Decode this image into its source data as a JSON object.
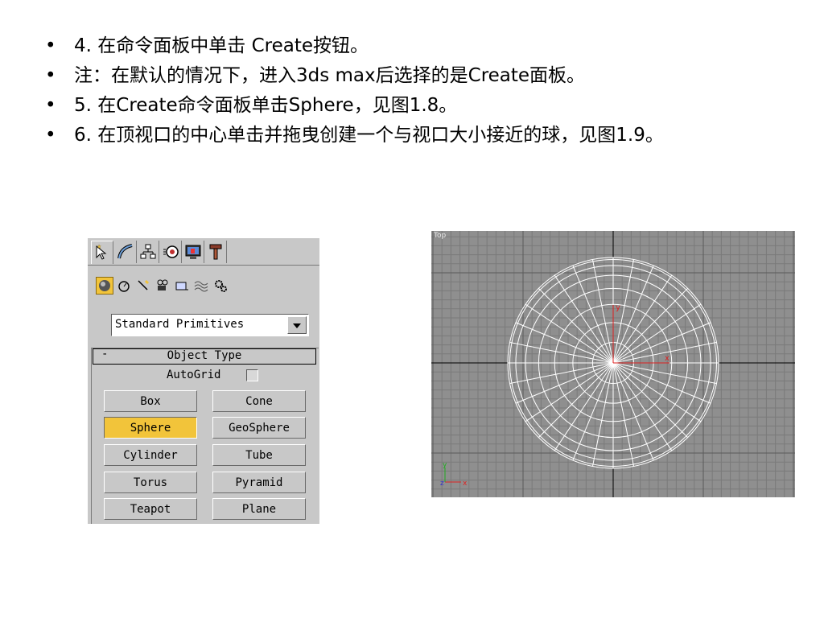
{
  "bullets": [
    "4. 在命令面板中单击  Create按钮。",
    "注：在默认的情况下，进入3ds max后选择的是Create面板。",
    "5. 在Create命令面板单击Sphere，见图1.8。",
    "6. 在顶视口的中心单击并拖曳创建一个与视口大小接近的球，见图1.9。"
  ],
  "bullet_symbol": "•",
  "command_panel": {
    "tabs": [
      "create-icon",
      "modify-icon",
      "hierarchy-icon",
      "motion-icon",
      "display-icon",
      "utilities-icon"
    ],
    "categories": [
      "geometry-icon",
      "shapes-icon",
      "lights-icon",
      "cameras-icon",
      "helpers-icon",
      "space-warps-icon",
      "systems-icon"
    ],
    "dropdown_value": "Standard Primitives",
    "rollout_toggle": "-",
    "rollout_title": "Object Type",
    "autogrid_label": "AutoGrid",
    "buttons": [
      {
        "label": "Box",
        "selected": false
      },
      {
        "label": "Cone",
        "selected": false
      },
      {
        "label": "Sphere",
        "selected": true
      },
      {
        "label": "GeoSphere",
        "selected": false
      },
      {
        "label": "Cylinder",
        "selected": false
      },
      {
        "label": "Tube",
        "selected": false
      },
      {
        "label": "Torus",
        "selected": false
      },
      {
        "label": "Pyramid",
        "selected": false
      },
      {
        "label": "Teapot",
        "selected": false
      },
      {
        "label": "Plane",
        "selected": false
      }
    ],
    "selected_color": "#f2c43a"
  },
  "viewport": {
    "label": "Top",
    "background": "#8f8f8f",
    "gizmo_axes": {
      "y": "y",
      "x": "x",
      "z": "z"
    },
    "local_axis_x": "x",
    "local_axis_y": "y"
  }
}
